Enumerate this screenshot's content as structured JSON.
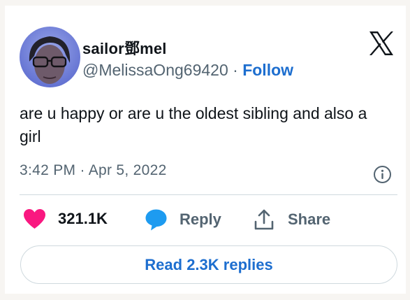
{
  "author": {
    "name": "sailor鄧mel",
    "handle": "@MelissaOng69420",
    "separator": "·",
    "follow_label": "Follow"
  },
  "tweet": {
    "text": "are u happy or are u the oldest sibling and also a girl",
    "timestamp": "3:42 PM · Apr 5, 2022"
  },
  "actions": {
    "like_count": "321.1K",
    "reply_label": "Reply",
    "share_label": "Share"
  },
  "read_replies_label": "Read 2.3K replies",
  "icons": {
    "brand": "x-logo-icon",
    "info": "info-icon",
    "like": "heart-icon",
    "reply": "speech-bubble-icon",
    "share": "share-upload-icon"
  },
  "colors": {
    "accent": "#1d6ecf",
    "heart": "#f91880",
    "muted": "#536471",
    "divider": "#cfd9de"
  }
}
